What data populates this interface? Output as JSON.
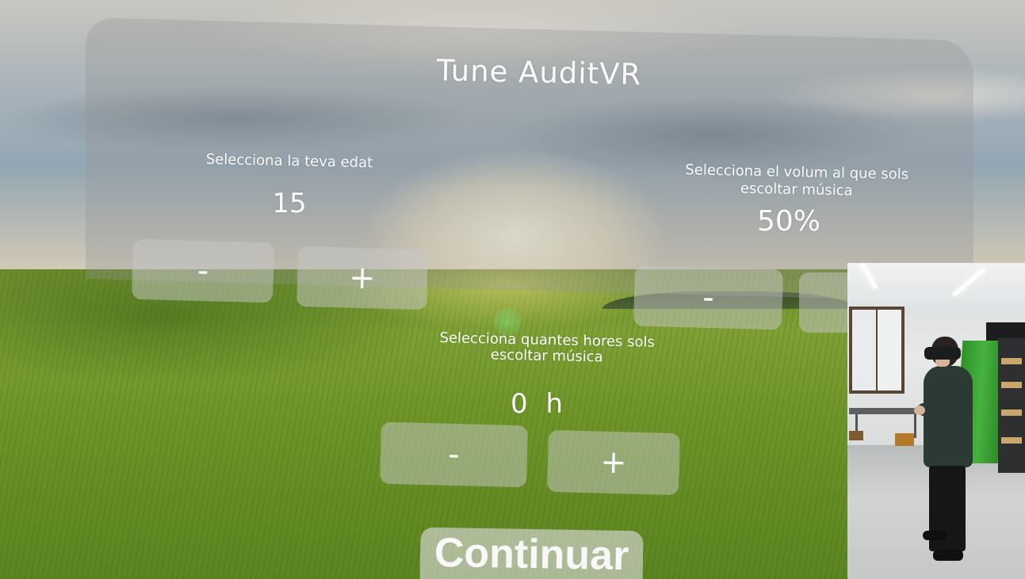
{
  "app": {
    "title": "Tune AuditVR"
  },
  "age": {
    "label": "Selecciona la teva edat",
    "value": "15",
    "minus_label": "-",
    "plus_label": "+"
  },
  "volume": {
    "label": "Selecciona el volum al que sols escoltar música",
    "value": "50%",
    "minus_label": "-"
  },
  "hours": {
    "label": "Selecciona quantes hores sols escoltar música",
    "value": "0 h",
    "minus_label": "-",
    "plus_label": "+"
  },
  "actions": {
    "continue_label": "Continuar"
  },
  "colors": {
    "panel": "#969696",
    "text": "#fbfbfb",
    "field_green": "#6d9428",
    "green_screen": "#47b33e"
  }
}
